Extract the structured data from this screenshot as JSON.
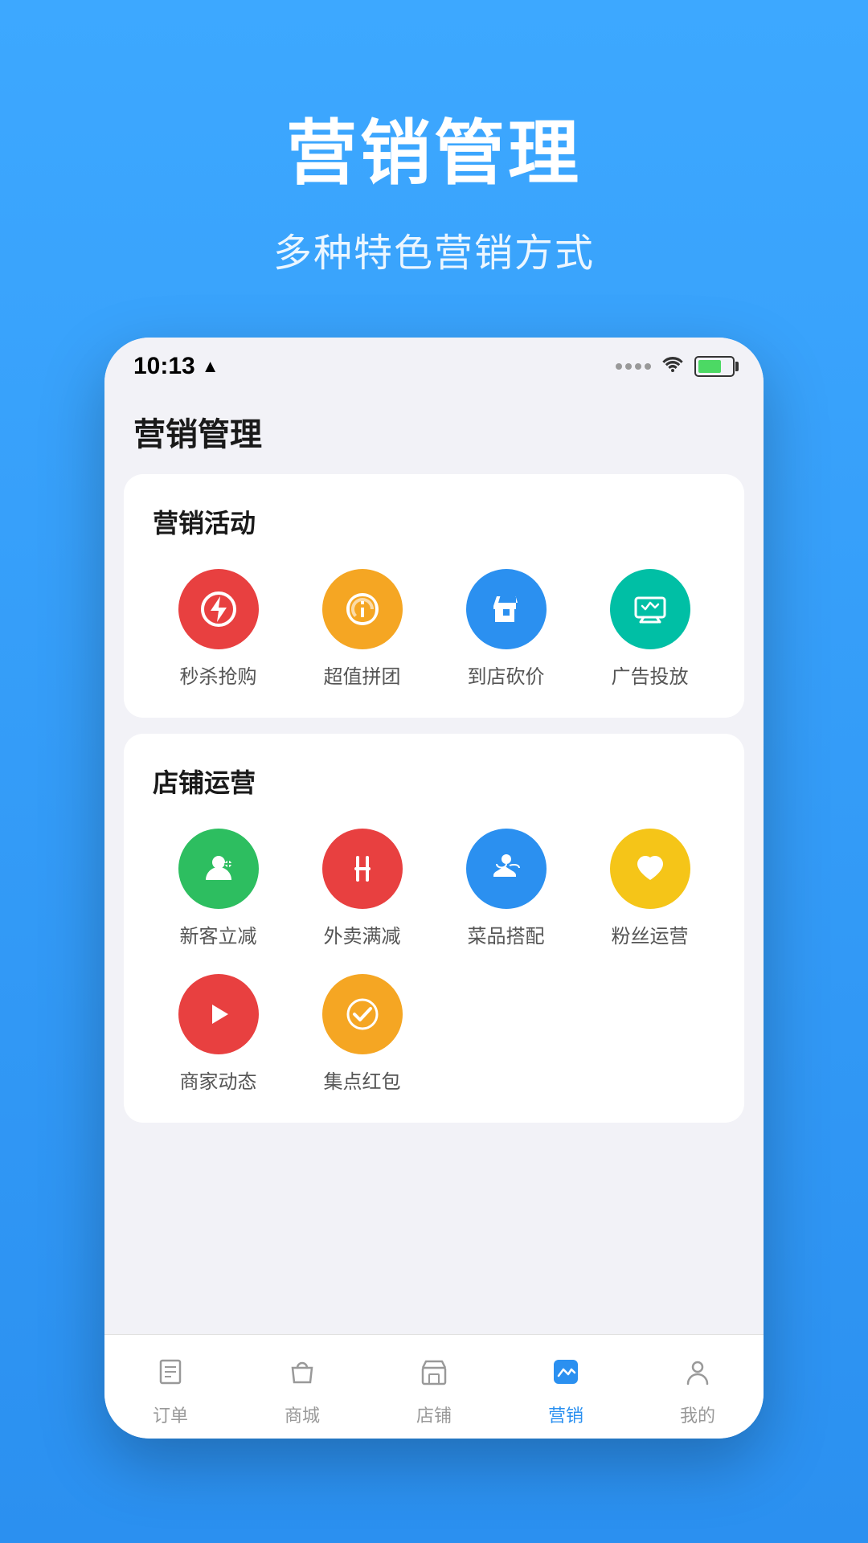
{
  "background_color": "#3da8ff",
  "header": {
    "title": "营销管理",
    "subtitle": "多种特色营销方式"
  },
  "status_bar": {
    "time": "10:13",
    "has_location": true
  },
  "app": {
    "title": "营销管理"
  },
  "marketing_section": {
    "title": "营销活动",
    "items": [
      {
        "id": "flash-sale",
        "label": "秒杀抢购",
        "icon": "⚡",
        "color": "ic-red"
      },
      {
        "id": "group-buy",
        "label": "超值拼团",
        "icon": "✦",
        "color": "ic-orange"
      },
      {
        "id": "in-store-discount",
        "label": "到店砍价",
        "icon": "✂",
        "color": "ic-blue"
      },
      {
        "id": "ads",
        "label": "广告投放",
        "icon": "📊",
        "color": "ic-teal"
      }
    ]
  },
  "store_section": {
    "title": "店铺运营",
    "items_row1": [
      {
        "id": "new-customer",
        "label": "新客立减",
        "icon": "👤",
        "color": "ic-green"
      },
      {
        "id": "delivery-discount",
        "label": "外卖满减",
        "icon": "🍴",
        "color": "ic-red2"
      },
      {
        "id": "menu-match",
        "label": "菜品搭配",
        "icon": "👍",
        "color": "ic-blue2"
      },
      {
        "id": "fans",
        "label": "粉丝运营",
        "icon": "♥",
        "color": "ic-yellow"
      }
    ],
    "items_row2": [
      {
        "id": "merchant-news",
        "label": "商家动态",
        "icon": "▶",
        "color": "ic-red3"
      },
      {
        "id": "points-red",
        "label": "集点红包",
        "icon": "✓",
        "color": "ic-orange2"
      }
    ]
  },
  "bottom_nav": {
    "items": [
      {
        "id": "orders",
        "label": "订单",
        "icon": "☰",
        "active": false
      },
      {
        "id": "mall",
        "label": "商城",
        "icon": "🛍",
        "active": false
      },
      {
        "id": "store",
        "label": "店铺",
        "icon": "◫",
        "active": false
      },
      {
        "id": "marketing",
        "label": "营销",
        "icon": "📈",
        "active": true
      },
      {
        "id": "me",
        "label": "我的",
        "icon": "👤",
        "active": false
      }
    ]
  }
}
